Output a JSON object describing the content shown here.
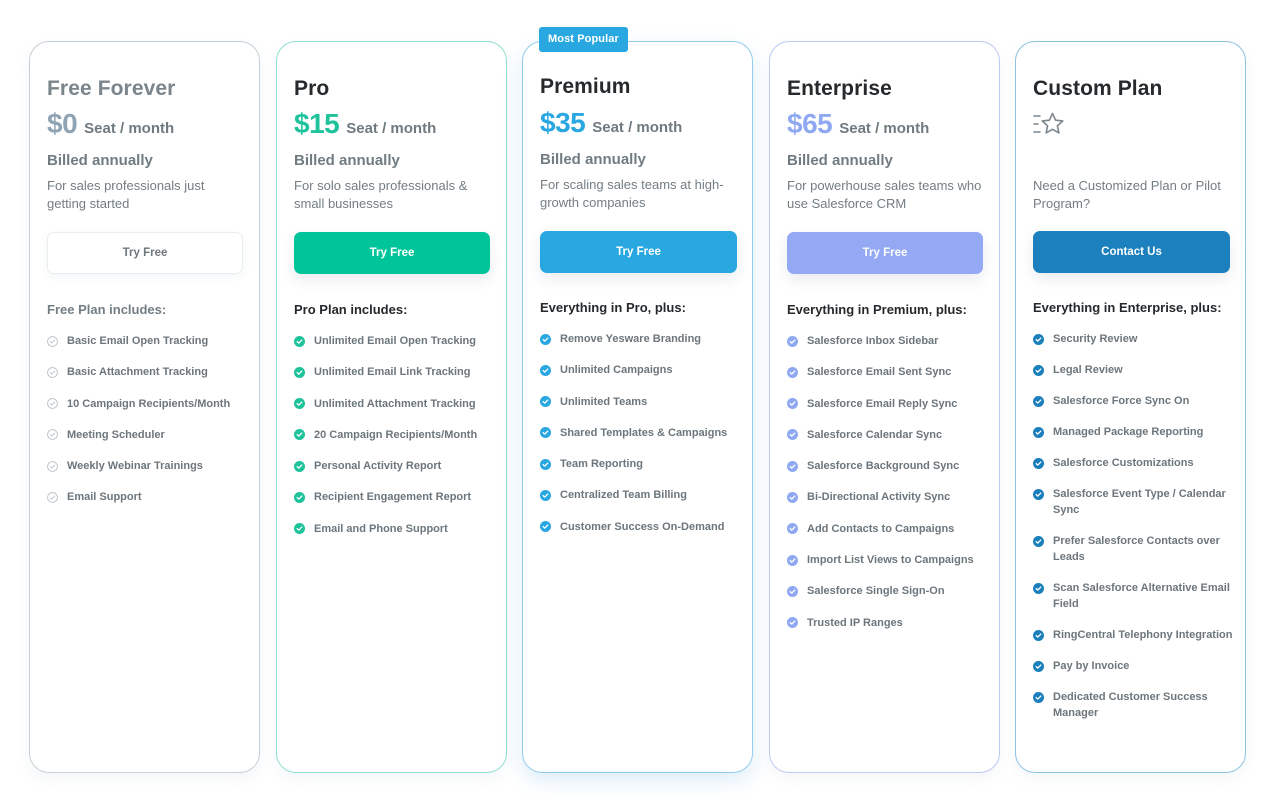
{
  "plans": [
    {
      "id": "free",
      "name": "Free Forever",
      "price": "$0",
      "price_unit": "Seat / month",
      "billing": "Billed annually",
      "description": "For sales professionals just getting started",
      "cta_label": "Try Free",
      "includes_title": "Free Plan includes:",
      "accent_color": "#8fa4b4",
      "check_style": "outline",
      "features": [
        "Basic Email Open Tracking",
        "Basic Attachment Tracking",
        "10 Campaign Recipients/Month",
        "Meeting Scheduler",
        "Weekly Webinar Trainings",
        "Email Support"
      ]
    },
    {
      "id": "pro",
      "name": "Pro",
      "price": "$15",
      "price_unit": "Seat / month",
      "billing": "Billed annually",
      "description": "For solo sales professionals & small businesses",
      "cta_label": "Try Free",
      "includes_title": "Pro Plan includes:",
      "accent_color": "#1ec39b",
      "button_color": "#00c49a",
      "check_style": "filled",
      "features": [
        "Unlimited Email Open Tracking",
        "Unlimited Email Link Tracking",
        "Unlimited Attachment Tracking",
        "20 Campaign Recipients/Month",
        "Personal Activity Report",
        "Recipient Engagement Report",
        "Email and Phone Support"
      ]
    },
    {
      "id": "premium",
      "name": "Premium",
      "badge": "Most Popular",
      "price": "$35",
      "price_unit": "Seat / month",
      "billing": "Billed annually",
      "description": "For scaling sales teams at high-growth companies",
      "cta_label": "Try Free",
      "includes_title": "Everything in Pro, plus:",
      "accent_color": "#29a7e1",
      "button_color": "#29a7e1",
      "check_style": "filled",
      "features": [
        "Remove Yesware Branding",
        "Unlimited Campaigns",
        "Unlimited Teams",
        "Shared Templates & Campaigns",
        "Team Reporting",
        "Centralized Team Billing",
        "Customer Success On-Demand"
      ]
    },
    {
      "id": "enterprise",
      "name": "Enterprise",
      "price": "$65",
      "price_unit": "Seat / month",
      "billing": "Billed annually",
      "description": "For powerhouse sales teams who use Salesforce CRM",
      "cta_label": "Try Free",
      "includes_title": "Everything in Premium, plus:",
      "accent_color": "#8fa8f2",
      "button_color": "#93a9f4",
      "check_style": "filled",
      "features": [
        "Salesforce Inbox Sidebar",
        "Salesforce Email Sent Sync",
        "Salesforce Email Reply Sync",
        "Salesforce Calendar Sync",
        "Salesforce Background Sync",
        "Bi-Directional Activity Sync",
        "Add Contacts to Campaigns",
        "Import List Views to Campaigns",
        "Salesforce Single Sign-On",
        "Trusted IP Ranges"
      ]
    },
    {
      "id": "custom",
      "name": "Custom Plan",
      "icon": "star-icon",
      "description": "Need a Customized Plan or Pilot Program?",
      "cta_label": "Contact Us",
      "includes_title": "Everything in Enterprise, plus:",
      "accent_color": "#1b7fbc",
      "button_color": "#1b80bd",
      "check_style": "filled",
      "features": [
        "Security Review",
        "Legal Review",
        "Salesforce Force Sync On",
        "Managed Package Reporting",
        "Salesforce Customizations",
        "Salesforce Event Type / Calendar Sync",
        "Prefer Salesforce Contacts over Leads",
        "Scan Salesforce Alternative Email Field",
        "RingCentral Telephony Integration",
        "Pay by Invoice",
        "Dedicated Customer Success Manager"
      ]
    }
  ]
}
